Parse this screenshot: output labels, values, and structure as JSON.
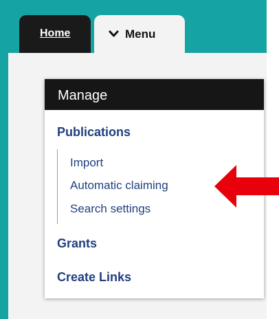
{
  "tabs": {
    "home_label": "Home",
    "menu_label": "Menu"
  },
  "manage": {
    "title": "Manage",
    "publications_label": "Publications",
    "sub_items": [
      {
        "label": "Import"
      },
      {
        "label": "Automatic claiming"
      },
      {
        "label": "Search settings"
      }
    ],
    "grants_label": "Grants",
    "create_links_label": "Create Links"
  },
  "colors": {
    "teal": "#16a3a3",
    "link_blue": "#1f3f7e",
    "arrow_red": "#e8000b",
    "header_dark": "#161616"
  },
  "icons": {
    "menu_chevron": "chevron-down-icon",
    "callout": "red-arrow-icon"
  }
}
